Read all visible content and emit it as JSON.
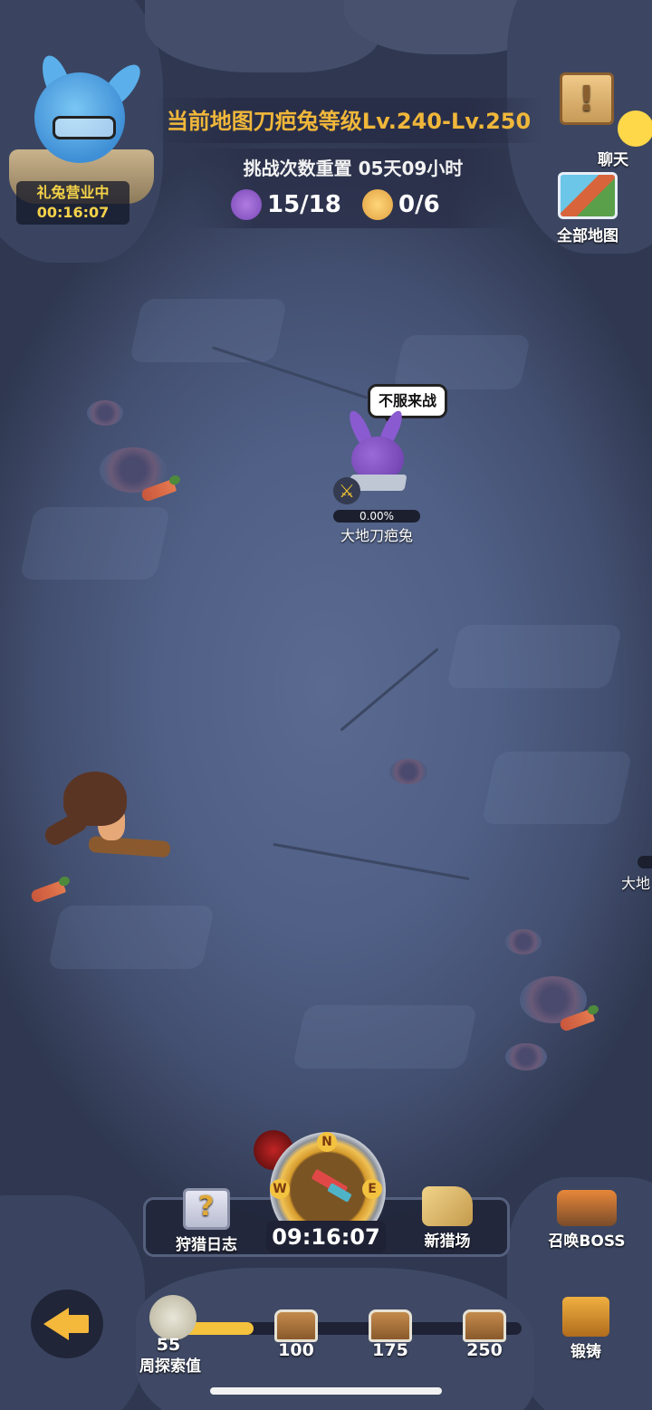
{
  "shop": {
    "label": "礼兔营业中",
    "timer": "00:16:07"
  },
  "header": {
    "map_title": "当前地图刀疤兔等级Lv.240-Lv.250",
    "reset_label": "挑战次数重置 05天09小时",
    "counter_purple": "15/18",
    "counter_gold": "0/6"
  },
  "side": {
    "chat_label": "聊天",
    "all_map_label": "全部地图"
  },
  "enemy": {
    "speech": "不服来战",
    "progress": "0.00%",
    "name": "大地刀疤兔"
  },
  "enemy_offscreen": {
    "name": "大地"
  },
  "bottom_panel": {
    "hunt_log_label": "狩猎日志",
    "compass_timer": "09:16:07",
    "new_hunt_label": "新猎场",
    "summon_boss_label": "召唤BOSS",
    "compass_dirs": {
      "n": "N",
      "w": "W",
      "e": "E"
    }
  },
  "progress": {
    "weekly_value": "55",
    "weekly_label": "周探索值",
    "fill_fraction": 0.22,
    "chests": [
      "100",
      "175",
      "250"
    ]
  },
  "forge_label": "锻铸",
  "icons": [
    "back-arrow-icon",
    "sword-icon",
    "chest-icon",
    "compass-icon",
    "chat-icon",
    "map-icon",
    "forge-icon",
    "skull-icon"
  ],
  "colors": {
    "title_gold": "#f0b73a",
    "accent_yellow": "#f4c23c"
  }
}
